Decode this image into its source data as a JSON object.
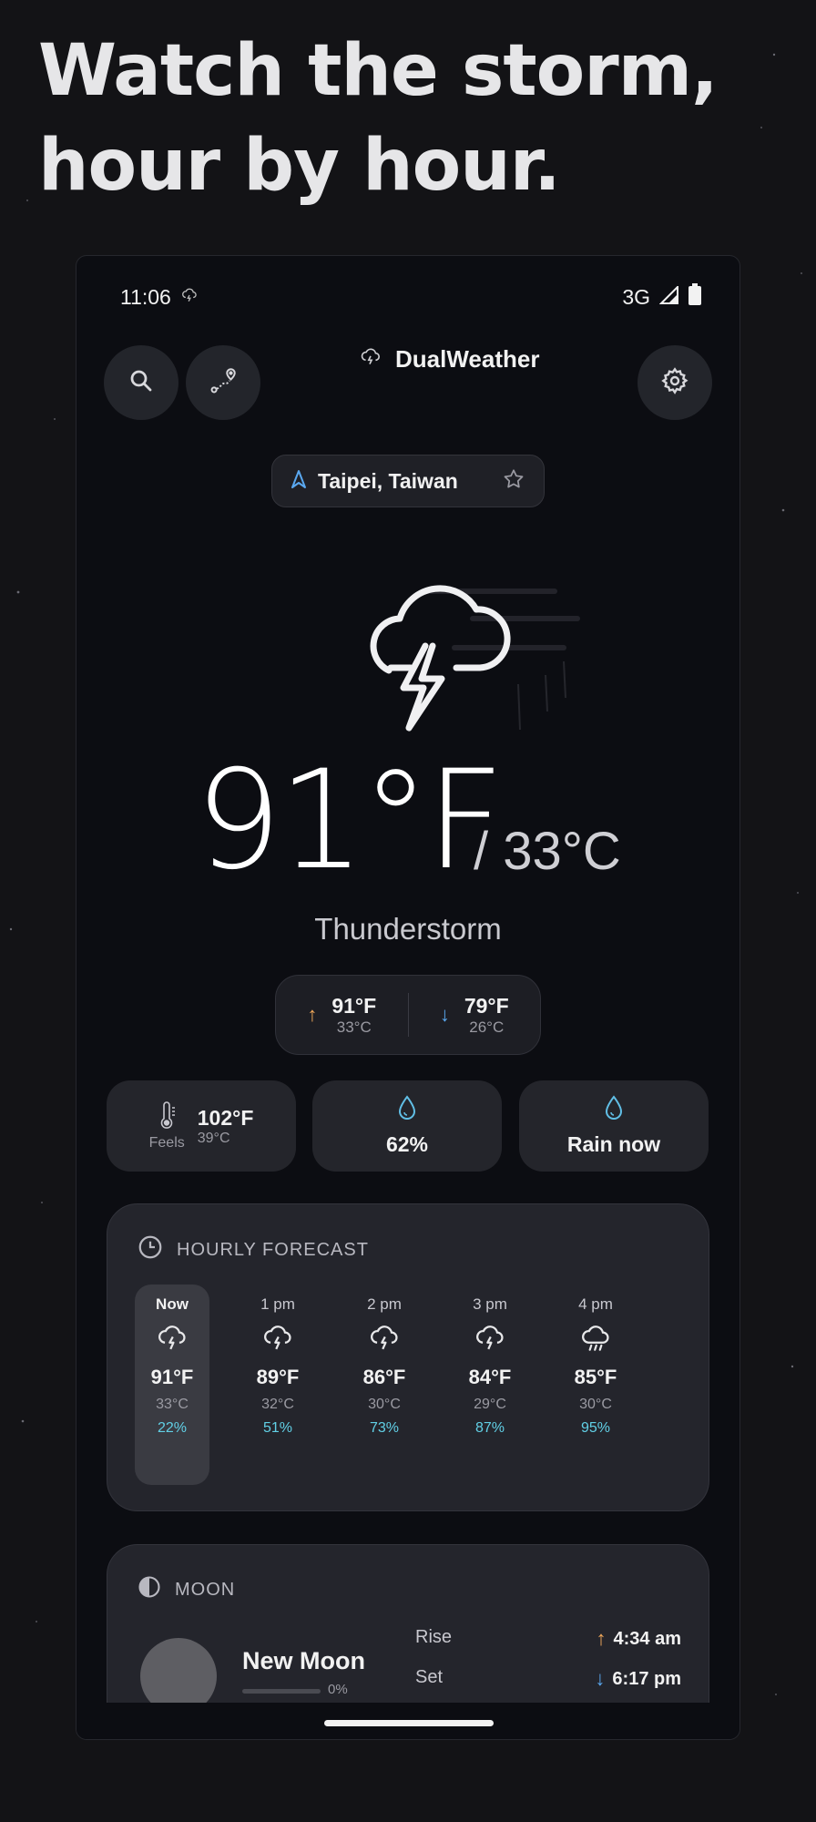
{
  "headline": [
    "Watch the storm,",
    "hour by hour."
  ],
  "status_bar": {
    "time": "11:06",
    "network": "3G"
  },
  "app": {
    "name": "DualWeather"
  },
  "location": {
    "name": "Taipei, Taiwan"
  },
  "current": {
    "temp_f": "91°F",
    "temp_c": "/ 33°C",
    "condition": "Thunderstorm",
    "high_f": "91°F",
    "high_c": "33°C",
    "low_f": "79°F",
    "low_c": "26°C"
  },
  "tiles": {
    "feels_label": "Feels",
    "feels_f": "102°F",
    "feels_c": "39°C",
    "humidity": "62%",
    "rain": "Rain now"
  },
  "hourly": {
    "title": "HOURLY FORECAST",
    "hours": [
      {
        "label": "Now",
        "temp_f": "91°F",
        "temp_c": "33°C",
        "precip": "22%",
        "icon": "thunderstorm-icon"
      },
      {
        "label": "1 pm",
        "temp_f": "89°F",
        "temp_c": "32°C",
        "precip": "51%",
        "icon": "thunderstorm-icon"
      },
      {
        "label": "2 pm",
        "temp_f": "86°F",
        "temp_c": "30°C",
        "precip": "73%",
        "icon": "thunderstorm-icon"
      },
      {
        "label": "3 pm",
        "temp_f": "84°F",
        "temp_c": "29°C",
        "precip": "87%",
        "icon": "thunderstorm-icon"
      },
      {
        "label": "4 pm",
        "temp_f": "85°F",
        "temp_c": "30°C",
        "precip": "95%",
        "icon": "rain-cloud-icon"
      }
    ]
  },
  "moon": {
    "title": "MOON",
    "phase": "New Moon",
    "illumination": "0%",
    "rise_label": "Rise",
    "rise_time": "4:34 am",
    "set_label": "Set",
    "set_time": "6:17 pm"
  },
  "colors": {
    "background": "#131316",
    "phone": "#0c0d12",
    "card": "#24252c",
    "precip": "#61d0e6",
    "high_arrow": "#f0a85a",
    "low_arrow": "#5aa8f0"
  }
}
